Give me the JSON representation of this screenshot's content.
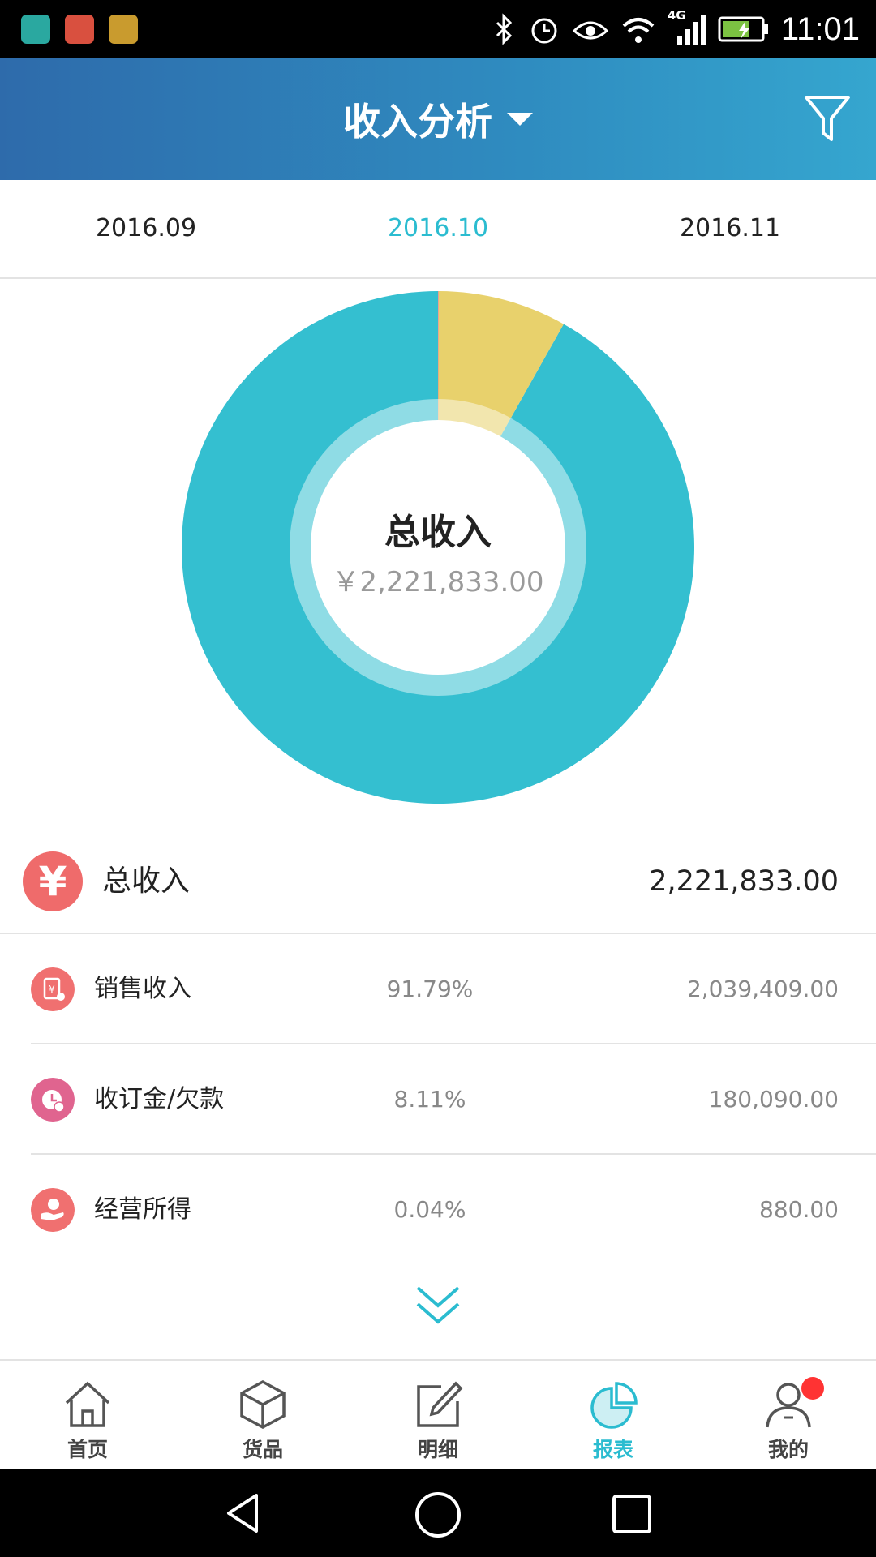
{
  "status_bar": {
    "time": "11:01",
    "network": "4G"
  },
  "header": {
    "title": "收入分析",
    "filter_icon": "filter-icon"
  },
  "months": [
    {
      "label": "2016.09",
      "active": false
    },
    {
      "label": "2016.10",
      "active": true
    },
    {
      "label": "2016.11",
      "active": false
    }
  ],
  "chart_data": {
    "type": "pie",
    "categories": [
      "销售收入",
      "收订金/欠款",
      "经营所得"
    ],
    "values": [
      91.79,
      8.11,
      0.04
    ],
    "colors": [
      "#34bfd0",
      "#e8d16c",
      "#e58a8a"
    ],
    "center_title": "总收入",
    "center_value": "￥2,221,833.00"
  },
  "summary": {
    "label": "总收入",
    "value": "2,221,833.00",
    "icon": "yen-icon"
  },
  "rows": [
    {
      "label": "销售收入",
      "percent": "91.79%",
      "value": "2,039,409.00",
      "icon": "sales-icon",
      "color": "#f07070"
    },
    {
      "label": "收订金/欠款",
      "percent": "8.11%",
      "value": "180,090.00",
      "icon": "deposit-clock-icon",
      "color": "#e0648f"
    },
    {
      "label": "经营所得",
      "percent": "0.04%",
      "value": "880.00",
      "icon": "hand-coin-icon",
      "color": "#f07070"
    }
  ],
  "tabs": [
    {
      "label": "首页",
      "icon": "home-icon",
      "active": false
    },
    {
      "label": "货品",
      "icon": "box-icon",
      "active": false
    },
    {
      "label": "明细",
      "icon": "edit-icon",
      "active": false
    },
    {
      "label": "报表",
      "icon": "pie-chart-icon",
      "active": true
    },
    {
      "label": "我的",
      "icon": "user-icon",
      "active": false
    }
  ],
  "accent": "#2bbcd0"
}
